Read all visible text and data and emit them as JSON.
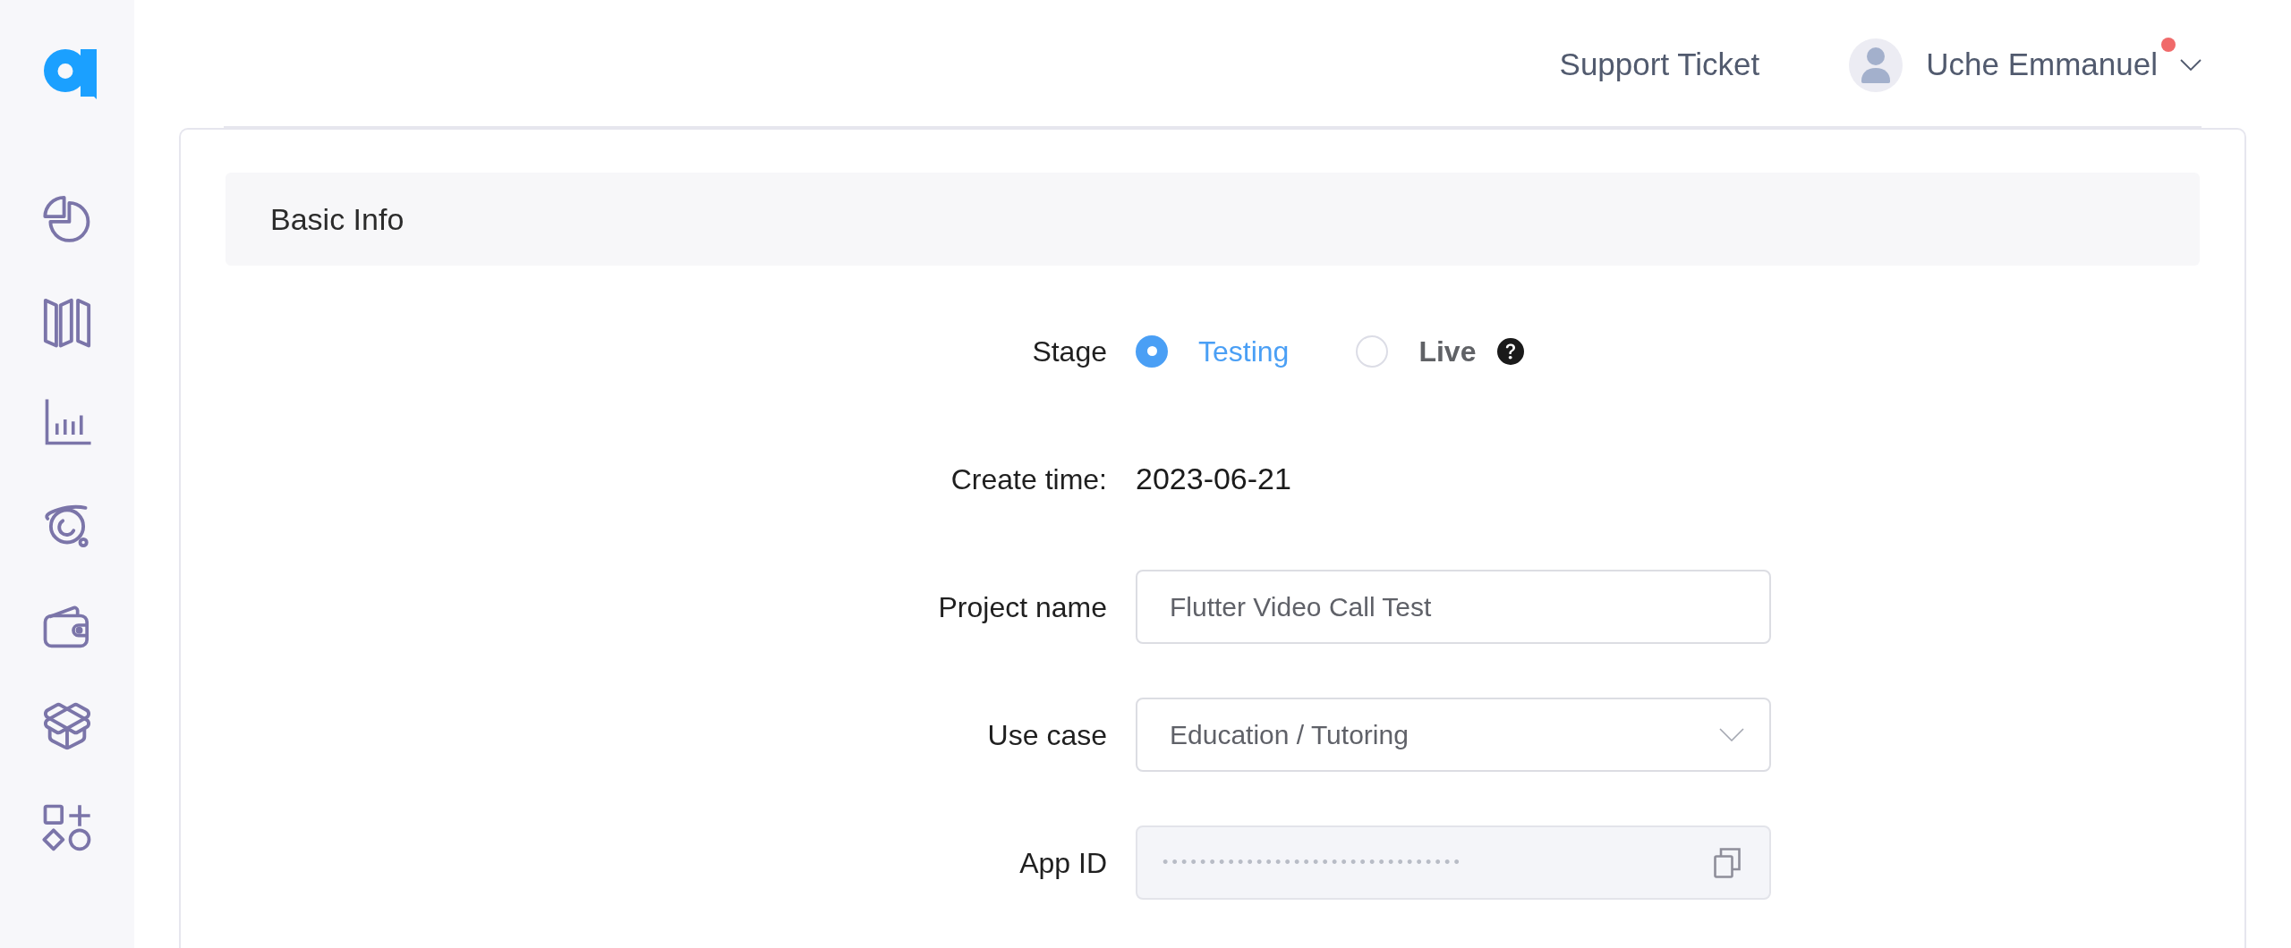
{
  "header": {
    "support_link": "Support Ticket",
    "user": {
      "name": "Uche Emmanuel",
      "notification": true
    }
  },
  "section": {
    "title": "Basic Info"
  },
  "fields": [
    {
      "kind": "radio",
      "label": "Stage",
      "help": true,
      "options": [
        {
          "label": "Testing",
          "selected": true
        },
        {
          "label": "Live",
          "selected": false
        }
      ]
    },
    {
      "kind": "text",
      "label": "Create time:",
      "value": "2023-06-21"
    },
    {
      "kind": "input",
      "label": "Project name",
      "value": "Flutter Video Call Test"
    },
    {
      "kind": "select",
      "label": "Use case",
      "value": "Education / Tutoring"
    },
    {
      "kind": "masked",
      "label": "App ID",
      "value": "••••••••••••••••••••••••••••••••"
    }
  ]
}
